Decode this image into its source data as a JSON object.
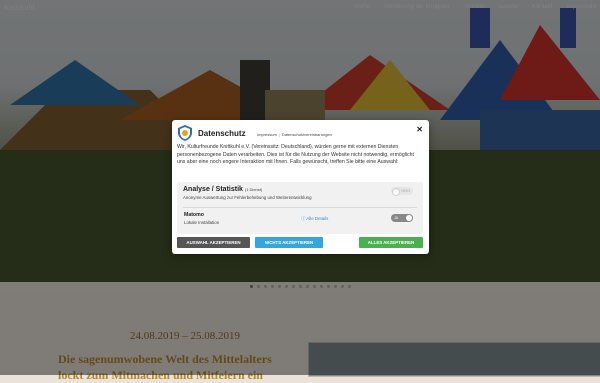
{
  "site": {
    "logo_text": "Knittkuhl",
    "menu": [
      "Home",
      "Vorstellung der Gruppen",
      "Termine",
      "Galerie",
      "Kontakt",
      "Impressum"
    ]
  },
  "event": {
    "date": "24.08.2019 – 25.08.2019",
    "tagline": "Die sagenumwobene Welt des Mittelalters",
    "tagline2": "lockt zum Mitmachen und Mitfeiern ein"
  },
  "consent": {
    "title": "Datenschutz",
    "links": [
      "Impressum",
      "Datenschutzvereinbarungen"
    ],
    "close_symbol": "✕",
    "intro": "Wir, Kulturfreunde Knittkuhl e.V. (Vereinssitz: Deutschland), würden gerne mit externen Diensten personenbezogene Daten verarbeiten. Dies ist für die Nutzung der Website nicht notwendig, ermöglicht uns aber eine noch engere Interaktion mit Ihnen. Falls gewünscht, treffen Sie bitte eine Auswahl:",
    "category": {
      "title": "Analyse / Statistik",
      "count": "(1 Dienst)",
      "description": "Anonyme Auswertung zur Fehlerbehebung und Weiterentwicklung",
      "toggle_label": "NEIN"
    },
    "service": {
      "name": "Matomo",
      "description": "Lokale Installation",
      "details_label": "Alle Details",
      "toggle_label": "JA"
    },
    "buttons": {
      "selection": "AUSWAHL AKZEPTIEREN",
      "reject": "NICHTS AKZEPTIEREN",
      "accept_all": "ALLES AKZEPTIEREN"
    }
  },
  "colors": {
    "accept_all": "#4caf50",
    "reject": "#35a5dd",
    "selection": "#555555",
    "link": "#2f8dd3"
  }
}
